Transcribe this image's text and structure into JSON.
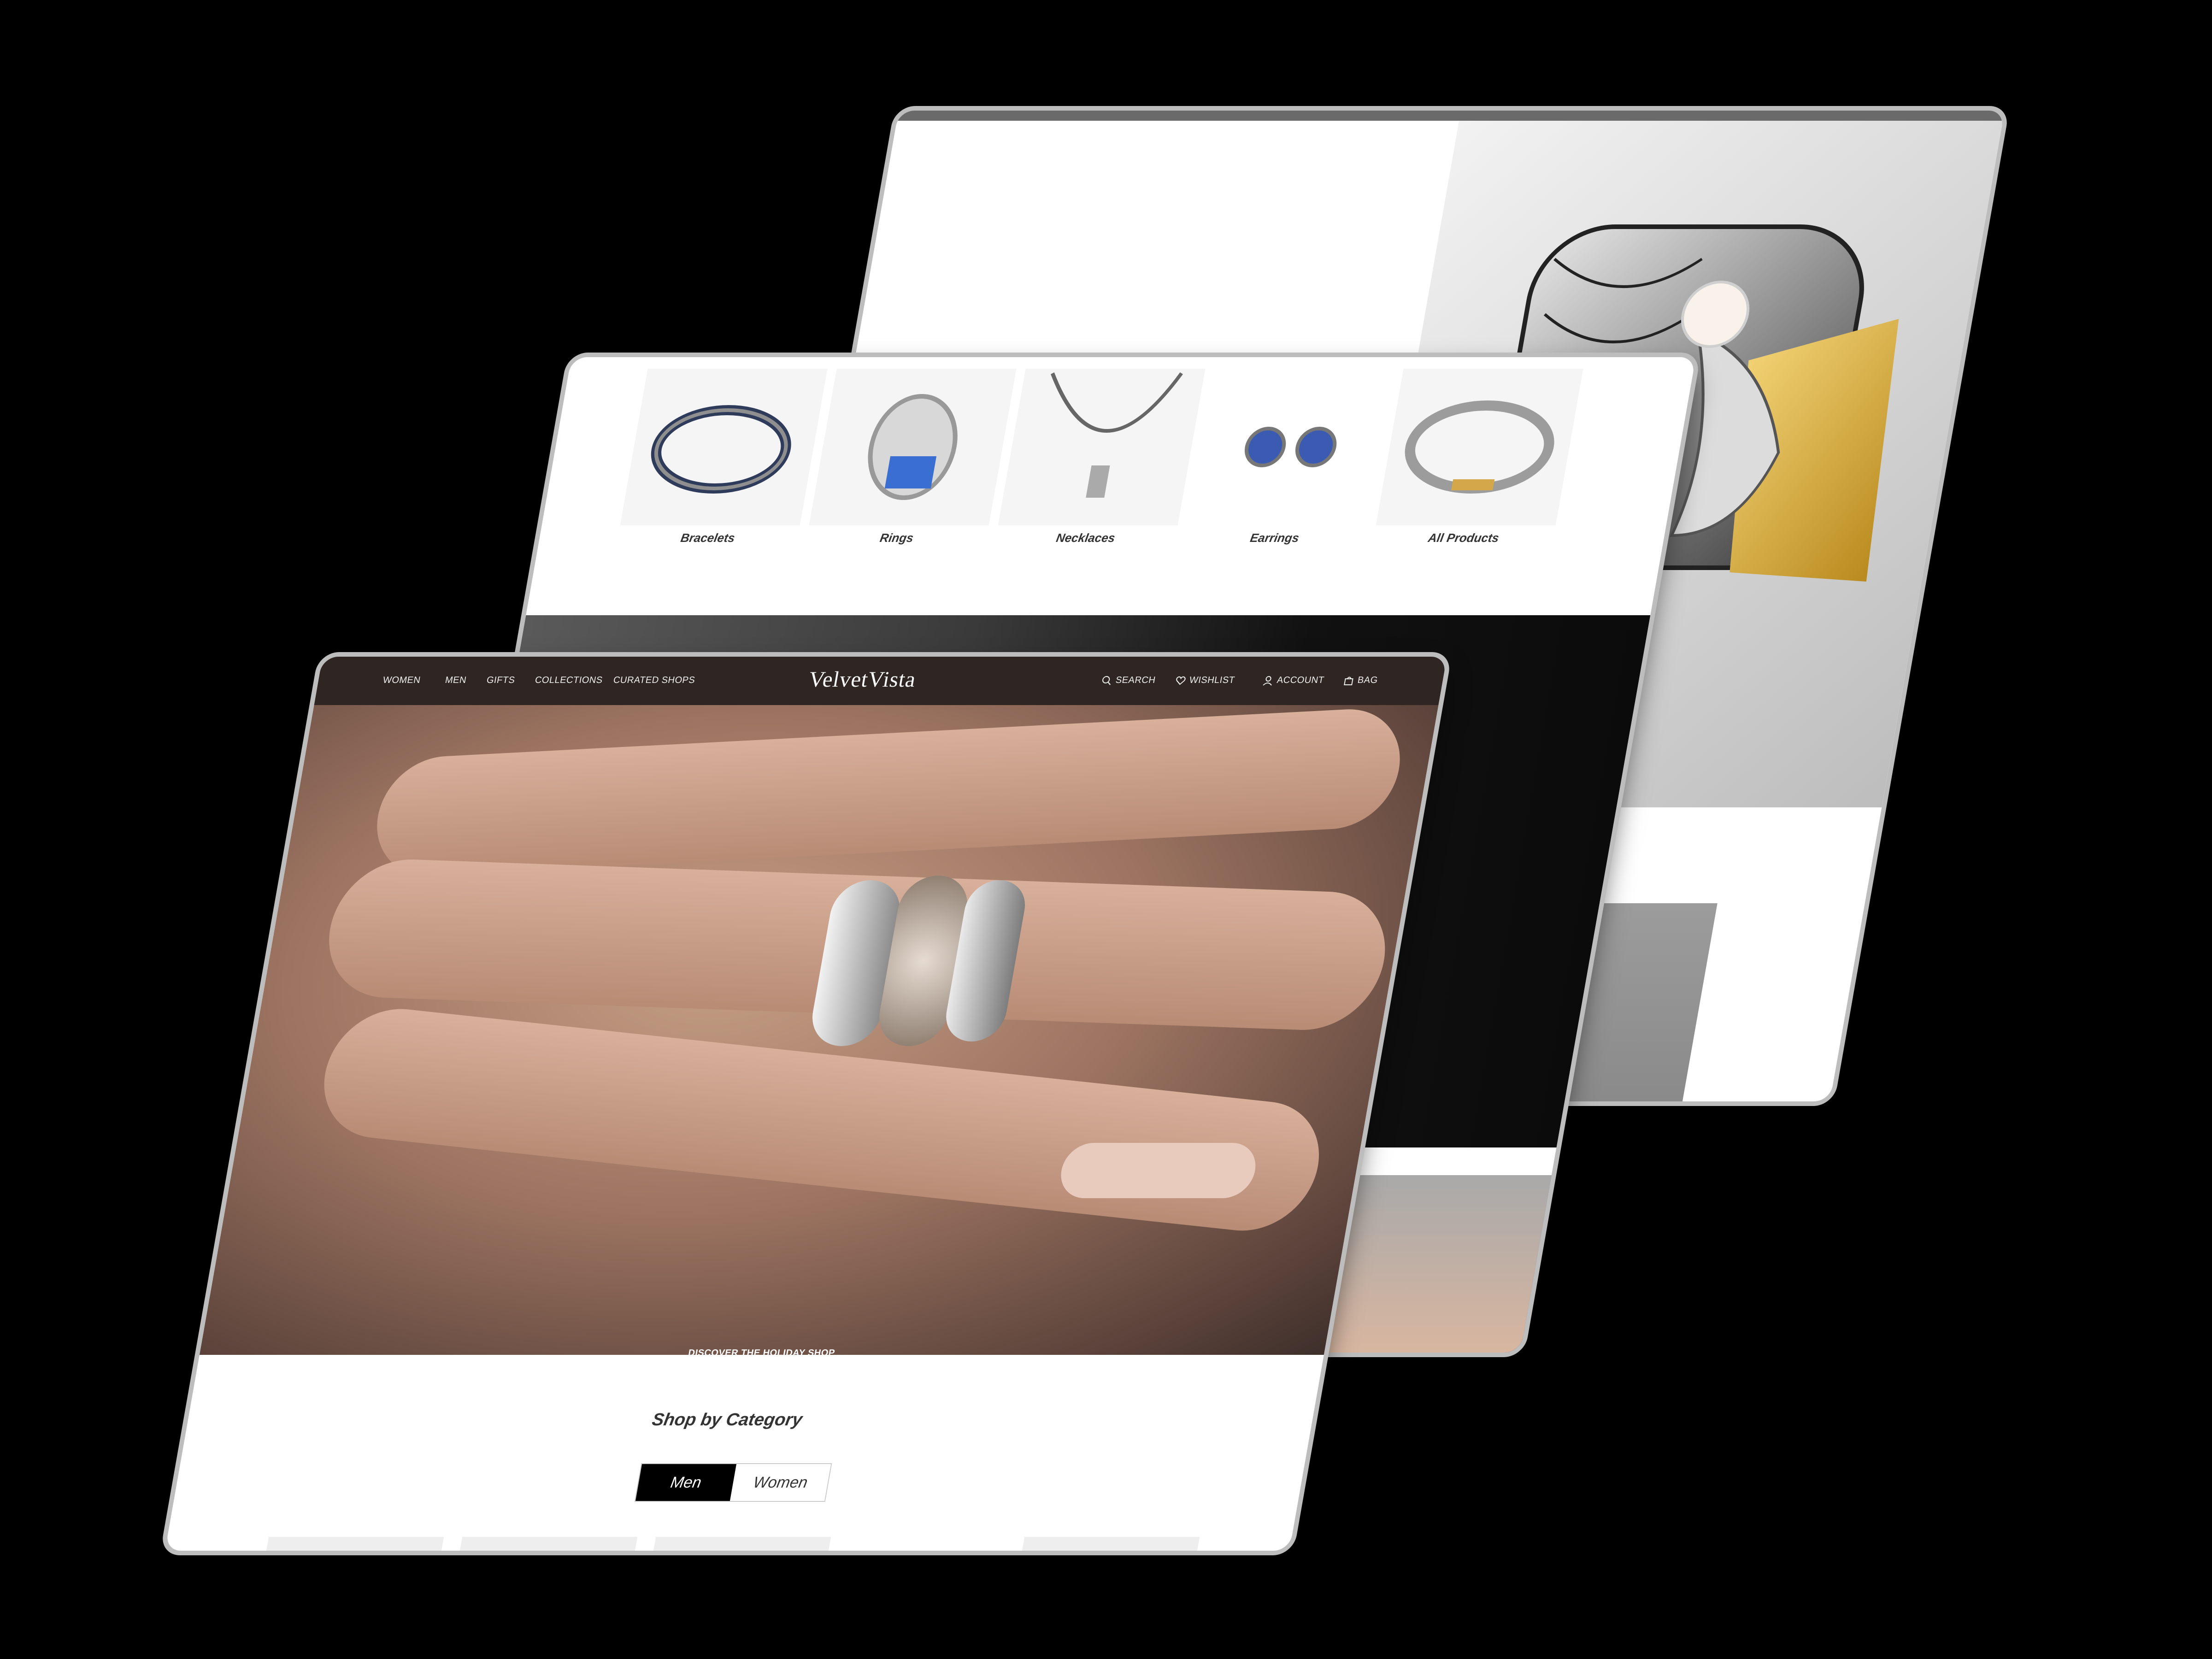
{
  "brand": {
    "name": "VelvetVista"
  },
  "nav": {
    "left": [
      "WOMEN",
      "MEN",
      "GIFTS",
      "COLLECTIONS",
      "CURATED SHOPS"
    ],
    "right": [
      {
        "label": "SEARCH",
        "icon": "search-icon"
      },
      {
        "label": "WISHLIST",
        "icon": "heart-icon"
      },
      {
        "label": "ACCOUNT",
        "icon": "user-icon"
      },
      {
        "label": "BAG",
        "icon": "bag-icon"
      }
    ]
  },
  "categories": [
    {
      "label": "Bracelets"
    },
    {
      "label": "Rings"
    },
    {
      "label": "Necklaces"
    },
    {
      "label": "Earrings"
    },
    {
      "label": "All Products"
    }
  ],
  "hero": {
    "cta": "DISCOVER THE HOLIDAY SHOP"
  },
  "shop_by_category": {
    "title": "Shop by Category",
    "toggle": {
      "options": [
        "Men",
        "Women"
      ],
      "selected": "Men"
    }
  },
  "colors": {
    "nav_bg": "#2f2623",
    "toggle_active_bg": "#000000",
    "page_bg": "#000000"
  }
}
